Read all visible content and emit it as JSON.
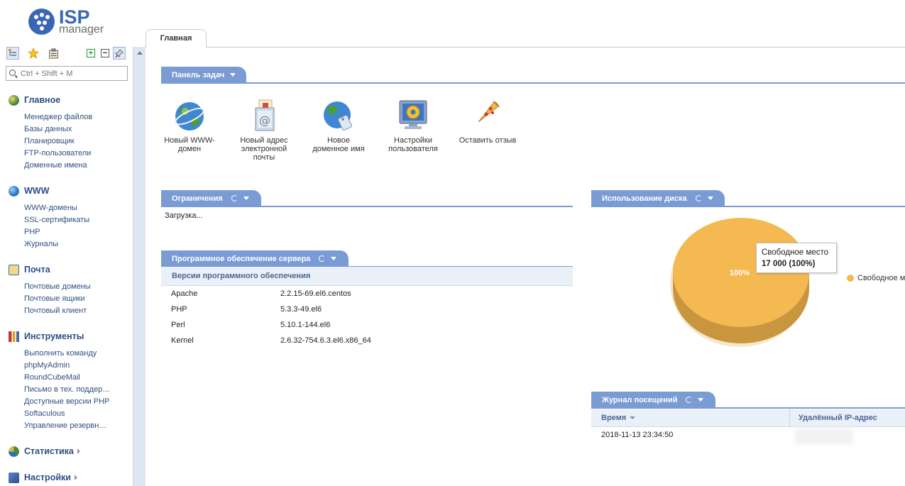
{
  "app": {
    "logo_primary": "ISP",
    "logo_secondary": "manager",
    "brand_color": "#3a67b4"
  },
  "search": {
    "placeholder": "Ctrl + Shift + M"
  },
  "sidebar": {
    "groups": [
      {
        "label": "Главное",
        "icon": "home-globe-icon",
        "items": [
          "Менеджер файлов",
          "Базы данных",
          "Планировщик",
          "FTP-пользователи",
          "Доменные имена"
        ]
      },
      {
        "label": "WWW",
        "icon": "www-globe-icon",
        "items": [
          "WWW-домены",
          "SSL-сертификаты",
          "PHP",
          "Журналы"
        ]
      },
      {
        "label": "Почта",
        "icon": "mail-icon",
        "items": [
          "Почтовые домены",
          "Почтовые ящики",
          "Почтовый клиент"
        ]
      },
      {
        "label": "Инструменты",
        "icon": "tools-icon",
        "items": [
          "Выполнить команду",
          "phpMyAdmin",
          "RoundCubeMail",
          "Письмо в тех. поддер…",
          "Доступные версии PHP",
          "Softaculous",
          "Управление резервн…"
        ]
      },
      {
        "label": "Статистика",
        "icon": "statistics-icon",
        "items": []
      },
      {
        "label": "Настройки",
        "icon": "settings-icon",
        "items": []
      }
    ]
  },
  "tabs": [
    {
      "label": "Главная"
    }
  ],
  "taskbar": {
    "title": "Панель задач",
    "tasks": [
      {
        "label": "Новый WWW-домен",
        "icon": "www-domain-icon"
      },
      {
        "label": "Новый адрес электронной почты",
        "icon": "email-address-icon"
      },
      {
        "label": "Новое доменное имя",
        "icon": "domain-name-icon"
      },
      {
        "label": "Настройки пользователя",
        "icon": "user-settings-icon"
      },
      {
        "label": "Оставить отзыв",
        "icon": "feedback-pizza-icon"
      }
    ]
  },
  "limits": {
    "title": "Ограничения",
    "status": "Загрузка..."
  },
  "software": {
    "title": "Программное обеспечение сервера",
    "subheader": "Версии программного обеспечения",
    "rows": [
      {
        "name": "Apache",
        "version": "2.2.15-69.el6.centos"
      },
      {
        "name": "PHP",
        "version": "5.3.3-49.el6"
      },
      {
        "name": "Perl",
        "version": "5.10.1-144.el6"
      },
      {
        "name": "Kernel",
        "version": "2.6.32-754.6.3.el6.x86_64"
      }
    ]
  },
  "disk": {
    "title": "Использование диска",
    "tooltip_name": "Свободное место",
    "tooltip_value": "17 000 (100%)",
    "slice_label": "100%",
    "legend": "Свободное м",
    "slice_color": "#f4b951"
  },
  "chart_data": {
    "type": "pie",
    "title": "",
    "slices": [
      {
        "name": "Свободное место",
        "value": 17000,
        "percent": 100
      }
    ]
  },
  "visits": {
    "title": "Журнал посещений",
    "columns": [
      "Время",
      "Удалённый IP-адрес"
    ],
    "rows": [
      {
        "time": "2018-11-13 23:34:50",
        "ip": ""
      }
    ]
  }
}
